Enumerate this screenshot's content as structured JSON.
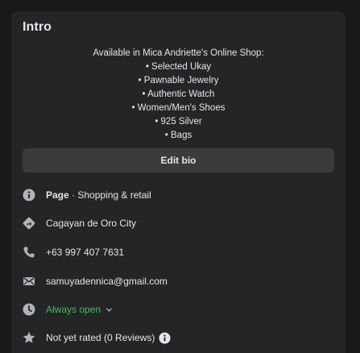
{
  "intro": {
    "title": "Intro",
    "bio_lines": [
      "Available in Mica Andriette's Online Shop:",
      "• Selected Ukay",
      "• Pawnable Jewelry",
      "• Authentic Watch",
      "• Women/Men's Shoes",
      "• 925 Silver",
      "• Bags"
    ],
    "edit_bio_label": "Edit bio",
    "page_label": "Page",
    "page_separator": " · ",
    "page_category": "Shopping & retail",
    "location": "Cagayan de Oro City",
    "phone": "+63 997 407 7631",
    "email": "samuyadennica@gmail.com",
    "hours": "Always open",
    "rating": "Not yet rated (0 Reviews)"
  },
  "colors": {
    "background": "#18191a",
    "card": "#242526",
    "button": "#3a3b3c",
    "text": "#e4e6eb",
    "open_status": "#45bd62"
  },
  "icons": [
    "info-icon",
    "directions-icon",
    "phone-icon",
    "email-icon",
    "clock-icon",
    "star-icon",
    "chevron-down-icon"
  ]
}
